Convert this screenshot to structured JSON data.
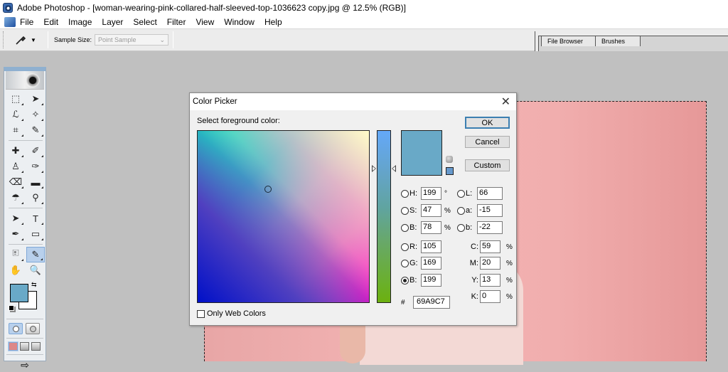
{
  "window": {
    "title": "Adobe Photoshop - [woman-wearing-pink-collared-half-sleeved-top-1036623 copy.jpg @ 12.5% (RGB)]",
    "app_icon": "photoshop-eye-icon"
  },
  "menubar": {
    "items": [
      "File",
      "Edit",
      "Image",
      "Layer",
      "Select",
      "Filter",
      "View",
      "Window",
      "Help"
    ]
  },
  "options_bar": {
    "tool_icon": "eyedropper-icon",
    "sample_size_label": "Sample Size:",
    "sample_size_value": "Point Sample"
  },
  "palette_well": {
    "tabs": [
      "File Browser",
      "Brushes"
    ]
  },
  "toolbox": {
    "tools": [
      {
        "name": "marquee",
        "glyph": "⬚"
      },
      {
        "name": "move",
        "glyph": "➤"
      },
      {
        "name": "lasso",
        "glyph": "ℒ"
      },
      {
        "name": "magic-wand",
        "glyph": "✧"
      },
      {
        "name": "crop",
        "glyph": "⌗"
      },
      {
        "name": "slice",
        "glyph": "✎"
      },
      {
        "name": "healing-brush",
        "glyph": "✚"
      },
      {
        "name": "brush",
        "glyph": "✐"
      },
      {
        "name": "clone-stamp",
        "glyph": "♙"
      },
      {
        "name": "history-brush",
        "glyph": "✑"
      },
      {
        "name": "eraser",
        "glyph": "⌫"
      },
      {
        "name": "gradient",
        "glyph": "▬"
      },
      {
        "name": "blur",
        "glyph": "☂"
      },
      {
        "name": "dodge",
        "glyph": "⚲"
      },
      {
        "name": "path-selection",
        "glyph": "➤"
      },
      {
        "name": "type",
        "glyph": "T"
      },
      {
        "name": "pen",
        "glyph": "✒"
      },
      {
        "name": "shape",
        "glyph": "▭"
      },
      {
        "name": "notes",
        "glyph": "🗉"
      },
      {
        "name": "eyedropper",
        "glyph": "✎",
        "active": true
      },
      {
        "name": "hand",
        "glyph": "✋"
      },
      {
        "name": "zoom",
        "glyph": "🔍"
      }
    ],
    "foreground_color": "#69A9C7",
    "background_color": "#FFFFFF"
  },
  "color_picker": {
    "title": "Color Picker",
    "prompt": "Select foreground color:",
    "buttons": {
      "ok": "OK",
      "cancel": "Cancel",
      "custom": "Custom"
    },
    "current_color": "#69A9C7",
    "web_safe_color": "#6699CC",
    "hsb": {
      "h": {
        "label": "H:",
        "value": "199",
        "unit": "°"
      },
      "s": {
        "label": "S:",
        "value": "47",
        "unit": "%"
      },
      "b": {
        "label": "B:",
        "value": "78",
        "unit": "%"
      }
    },
    "lab": {
      "l": {
        "label": "L:",
        "value": "66"
      },
      "a": {
        "label": "a:",
        "value": "-15"
      },
      "b": {
        "label": "b:",
        "value": "-22"
      }
    },
    "rgb": {
      "r": {
        "label": "R:",
        "value": "105"
      },
      "g": {
        "label": "G:",
        "value": "169"
      },
      "b": {
        "label": "B:",
        "value": "199",
        "selected": true
      }
    },
    "cmyk": {
      "c": {
        "label": "C:",
        "value": "59",
        "unit": "%"
      },
      "m": {
        "label": "M:",
        "value": "20",
        "unit": "%"
      },
      "y": {
        "label": "Y:",
        "value": "13",
        "unit": "%"
      },
      "k": {
        "label": "K:",
        "value": "0",
        "unit": "%"
      }
    },
    "hex_label": "#",
    "hex_value": "69A9C7",
    "only_web_colors_label": "Only Web Colors",
    "only_web_colors_checked": false,
    "slider_channel": "B",
    "slider_value": 199
  }
}
